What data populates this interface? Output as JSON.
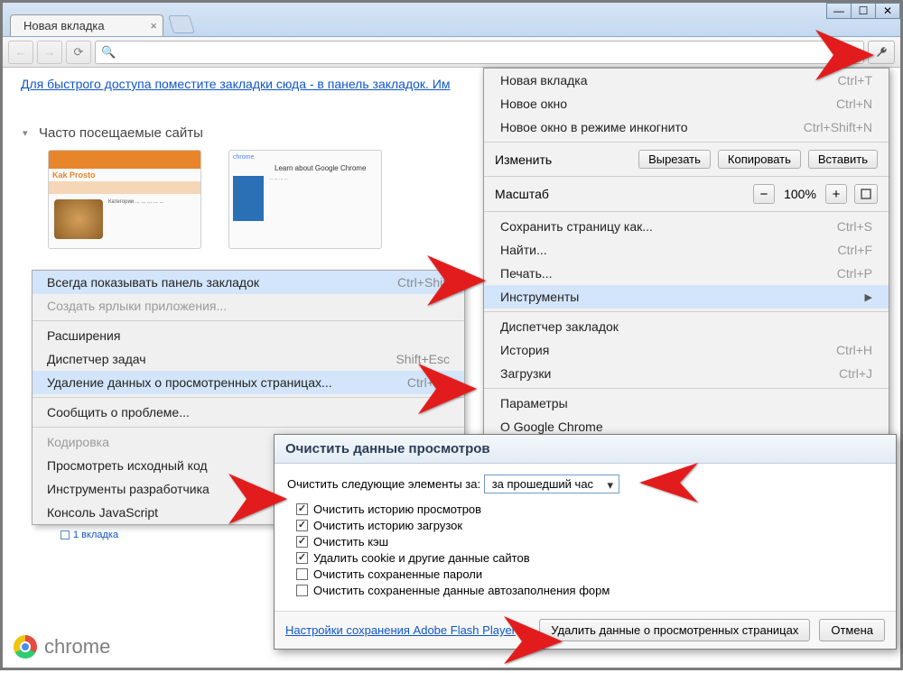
{
  "window_controls": {
    "minimize": "—",
    "maximize": "☐",
    "close": "✕"
  },
  "tab": {
    "title": "Новая вкладка"
  },
  "toolbar": {
    "back": "←",
    "forward": "→",
    "reload": "⟳"
  },
  "page": {
    "bookmarks_hint": "Для быстрого доступа поместите закладки сюда - в панель закладок.  Им",
    "section_title": "Часто посещаемые сайты",
    "thumb1_logo": "Kak Prosto",
    "thumb2_brand": "chrome",
    "thumb2_hdr": "Learn about Google Chrome"
  },
  "submenu": {
    "items": [
      {
        "label": "Всегда показывать панель закладок",
        "shortcut": "Ctrl+Shift",
        "disabled": false,
        "hi": true
      },
      {
        "label": "Создать ярлыки приложения...",
        "shortcut": "",
        "disabled": true
      },
      {
        "sep": true
      },
      {
        "label": "Расширения"
      },
      {
        "label": "Диспетчер задач",
        "shortcut": "Shift+Esc"
      },
      {
        "label": "Удаление данных о просмотренных страницах...",
        "shortcut": "Ctrl+Sh",
        "hi": true
      },
      {
        "sep": true
      },
      {
        "label": "Сообщить о проблеме..."
      },
      {
        "sep": true
      },
      {
        "label": "Кодировка",
        "disabled": true
      },
      {
        "label": "Просмотреть исходный код"
      },
      {
        "label": "Инструменты разработчика"
      },
      {
        "label": "Консоль JavaScript"
      }
    ]
  },
  "mainmenu": {
    "items": [
      {
        "label": "Новая вкладка",
        "shortcut": "Ctrl+T"
      },
      {
        "label": "Новое окно",
        "shortcut": "Ctrl+N"
      },
      {
        "label": "Новое окно в режиме инкогнито",
        "shortcut": "Ctrl+Shift+N"
      },
      {
        "sep": true
      },
      {
        "edit_row": true,
        "label": "Изменить",
        "cut": "Вырезать",
        "copy": "Копировать",
        "paste": "Вставить"
      },
      {
        "sep": true
      },
      {
        "zoom_row": true,
        "label": "Масштаб",
        "minus": "−",
        "value": "100%",
        "plus": "+"
      },
      {
        "sep": true
      },
      {
        "label": "Сохранить страницу как...",
        "shortcut": "Ctrl+S"
      },
      {
        "label": "Найти...",
        "shortcut": "Ctrl+F"
      },
      {
        "label": "Печать...",
        "shortcut": "Ctrl+P"
      },
      {
        "label": "Инструменты",
        "shortcut": "",
        "hi": true,
        "submenu": true
      },
      {
        "sep": true
      },
      {
        "label": "Диспетчер закладок"
      },
      {
        "label": "История",
        "shortcut": "Ctrl+H"
      },
      {
        "label": "Загрузки",
        "shortcut": "Ctrl+J"
      },
      {
        "sep": true
      },
      {
        "label": "Параметры"
      },
      {
        "label": "О Google Chrome"
      }
    ]
  },
  "dialog": {
    "title": "Очистить данные просмотров",
    "period_label": "Очистить следующие элементы за:",
    "period_value": "за прошедший час",
    "checkboxes": [
      {
        "label": "Очистить историю просмотров",
        "checked": true
      },
      {
        "label": "Очистить историю загрузок",
        "checked": true
      },
      {
        "label": "Очистить кэш",
        "checked": true
      },
      {
        "label": "Удалить cookie и другие данные сайтов",
        "checked": true
      },
      {
        "label": "Очистить сохраненные пароли",
        "checked": false
      },
      {
        "label": "Очистить сохраненные данные автозаполнения форм",
        "checked": false
      }
    ],
    "flash_link": "Настройки сохранения Adobe Flash Player",
    "confirm": "Удалить данные о просмотренных страницах",
    "cancel": "Отмена"
  },
  "brand": "chrome",
  "tab_count": "1 вкладка"
}
